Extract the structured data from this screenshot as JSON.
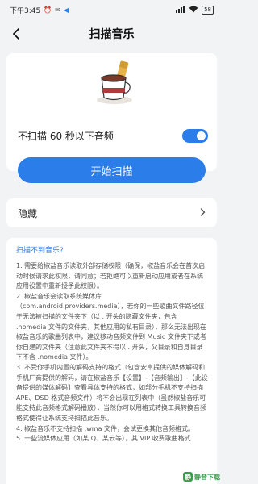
{
  "status_bar": {
    "time": "下午3:45",
    "battery": "58",
    "icons": [
      "alarm-icon",
      "email-icon",
      "telegram-icon",
      "signal-icon",
      "wifi-icon"
    ]
  },
  "header": {
    "title": "扫描音乐",
    "back_icon": "arrow-left-icon"
  },
  "scan_card": {
    "illustration": "coffee-cup-icon",
    "toggle_label": "不扫描 60 秒以下音频",
    "toggle_on": true,
    "start_button": "开始扫描"
  },
  "hidden_row": {
    "label": "隐藏",
    "chevron": "chevron-right-icon"
  },
  "faq": {
    "title": "扫描不到音乐?",
    "paragraphs": [
      "1. 需要给椒盐音乐读取外部存储权限（确保，椒盐音乐会在首次启动时候请求此权限，请同意；若拒绝可以重新启动应用或者在系统应用设置中重新授予此权限）。",
      "2. 椒盐音乐会读取系统媒体库（com.android.providers.media），若你的一些歌曲文件路径位于无法被扫描的文件夹下（以 . 开头的隐藏文件夹，包含 .nomedia 文件的文件夹，其他应用的私有目录），那么无法出现在椒盐音乐的歌曲列表中，建议移动音频文件到 Music 文件夹下或者你自建的文件夹（注意此文件夹不得以 . 开头，父目录和自身目录下不含 .nomedia 文件）。",
      "3. 不受你手机内置的解码支持的格式（包含安卓提供的媒体解码和手机厂商提供的解码，请在椒盐音乐【设置】-【音频输出】-【此设备提供的媒体解码】查看具体支持的格式，如部分手机不支持扫描 APE、DSD 格式音频文件）将不会出现在列表中（虽然椒盐音乐可能支持此音频格式解码播放），当然你可以用格式转换工具转换音频格式使得让系统支持扫描此音乐。",
      "4. 椒盐音乐不支持扫描 .wma 文件，会试更换其他音频格式。",
      "5. 一些流媒体应用（如某 Q、某云等），其 VIP 收费歌曲格式"
    ]
  },
  "watermark": {
    "text": "静音下载",
    "logo_glyph": "静"
  }
}
